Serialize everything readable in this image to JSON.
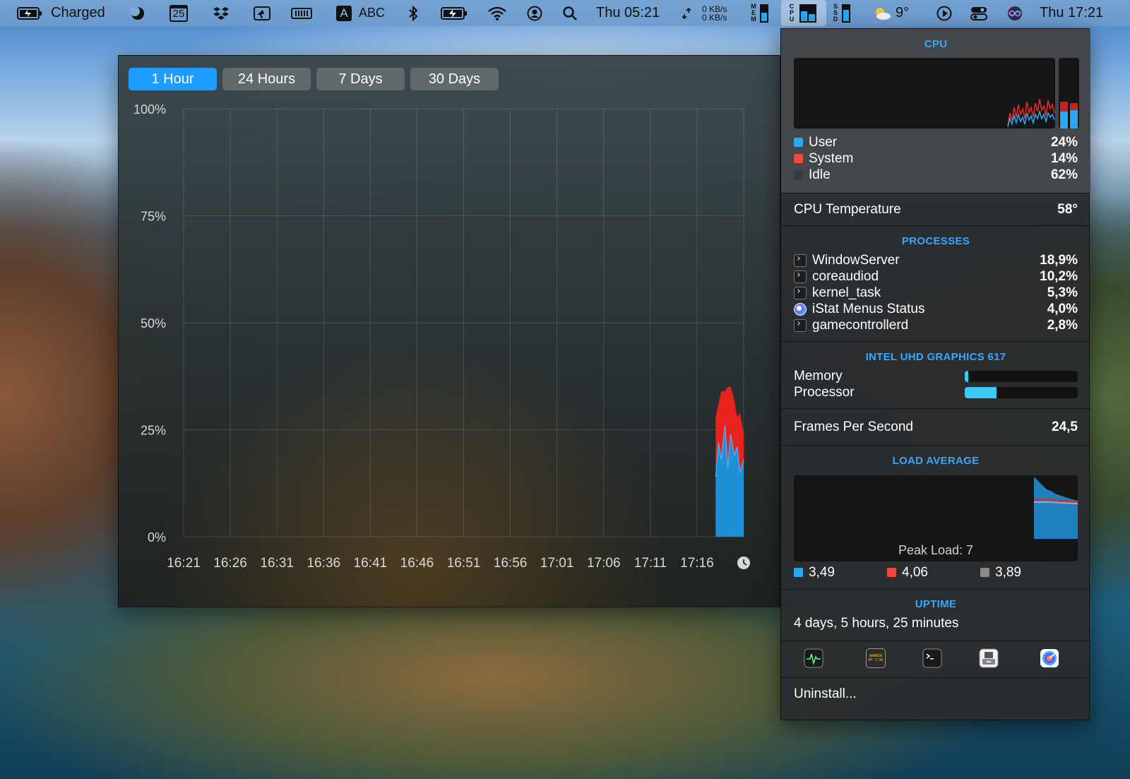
{
  "menubar": {
    "battery_label": "Charged",
    "calendar_day": "25",
    "input_source_letter": "A",
    "input_source_label": "ABC",
    "time_left": "Thu 05:21",
    "net_up": "0 KB/s",
    "net_down": "0 KB/s",
    "mem_label": "MEM",
    "cpu_label": "CPU",
    "ssd_label": "SSD",
    "weather_temp": "9°",
    "clock": "Thu 17:21",
    "icons": [
      "battery-icon",
      "moon-icon",
      "calendar-icon",
      "dropbox-icon",
      "pointer-icon",
      "memory-chip-icon",
      "input-source-icon",
      "bluetooth-icon",
      "battery-charging-icon",
      "wifi-icon",
      "user-icon",
      "search-icon",
      "network-arrows-icon",
      "weather-icon",
      "play-icon",
      "control-center-icon",
      "siri-icon"
    ]
  },
  "history": {
    "tabs": [
      {
        "label": "1 Hour",
        "active": true
      },
      {
        "label": "24 Hours",
        "active": false
      },
      {
        "label": "7 Days",
        "active": false
      },
      {
        "label": "30 Days",
        "active": false
      }
    ]
  },
  "chart_data": {
    "type": "area",
    "title": "",
    "xlabel": "",
    "ylabel": "",
    "ylim": [
      0,
      100
    ],
    "y_ticks": [
      "100%",
      "75%",
      "50%",
      "25%",
      "0%"
    ],
    "x": [
      "16:21",
      "16:26",
      "16:31",
      "16:36",
      "16:41",
      "16:46",
      "16:51",
      "16:56",
      "17:01",
      "17:06",
      "17:11",
      "17:16"
    ],
    "x_tick_labels": [
      "16:21",
      "16:26",
      "16:31",
      "16:36",
      "16:41",
      "16:46",
      "16:51",
      "16:56",
      "17:01",
      "17:06",
      "17:11",
      "17:16"
    ],
    "x_minutes_range": [
      "16:21",
      "17:21"
    ],
    "series": [
      {
        "color": "#1f8fd6",
        "stack": "user",
        "x": [
          "17:18",
          "17:18.3",
          "17:18.6",
          "17:19",
          "17:19.3",
          "17:19.6",
          "17:20",
          "17:20.3",
          "17:20.6",
          "17:21"
        ],
        "values": [
          14,
          22,
          18,
          26,
          16,
          24,
          19,
          21,
          15,
          18
        ]
      },
      {
        "color": "#e8221c",
        "stack": "system",
        "x": [
          "17:18",
          "17:18.3",
          "17:18.6",
          "17:19",
          "17:19.3",
          "17:19.6",
          "17:20",
          "17:20.3",
          "17:20.6",
          "17:21"
        ],
        "values": [
          14,
          9,
          16,
          8,
          19,
          11,
          13,
          7,
          14,
          6
        ]
      }
    ],
    "grid": true,
    "legend": "none"
  },
  "popup": {
    "cpu_header": "CPU",
    "usage": [
      {
        "label": "User",
        "value": "24%",
        "color": "#2aa7f3"
      },
      {
        "label": "System",
        "value": "14%",
        "color": "#f0483e"
      },
      {
        "label": "Idle",
        "value": "62%",
        "color": "#3a3a3a"
      }
    ],
    "temperature_label": "CPU Temperature",
    "temperature_value": "58°",
    "processes_header": "PROCESSES",
    "processes": [
      {
        "name": "WindowServer",
        "value": "18,9%",
        "icon": "terminal-icon"
      },
      {
        "name": "coreaudiod",
        "value": "10,2%",
        "icon": "terminal-icon"
      },
      {
        "name": "kernel_task",
        "value": "5,3%",
        "icon": "terminal-icon"
      },
      {
        "name": "iStat Menus Status",
        "value": "4,0%",
        "icon": "istat-icon"
      },
      {
        "name": "gamecontrollerd",
        "value": "2,8%",
        "icon": "terminal-icon"
      }
    ],
    "gpu_header": "INTEL UHD GRAPHICS 617",
    "gpu": [
      {
        "label": "Memory",
        "fraction": 0.03
      },
      {
        "label": "Processor",
        "fraction": 0.28
      }
    ],
    "fps_label": "Frames Per Second",
    "fps_value": "24,5",
    "load_header": "LOAD AVERAGE",
    "peak_load": "Peak Load: 7",
    "load_values": [
      {
        "value": "3,49",
        "color": "#2aa7f3"
      },
      {
        "value": "4,06",
        "color": "#f0483e"
      },
      {
        "value": "3,89",
        "color": "#8a8a8a"
      }
    ],
    "uptime_header": "UPTIME",
    "uptime_value": "4 days, 5 hours, 25 minutes",
    "dock_icons": [
      "activity-monitor-icon",
      "console-icon",
      "terminal-icon",
      "system-information-icon",
      "istat-menus-icon"
    ],
    "dock_console_text": "WARNIN\n0Y 7:36",
    "uninstall_label": "Uninstall..."
  }
}
